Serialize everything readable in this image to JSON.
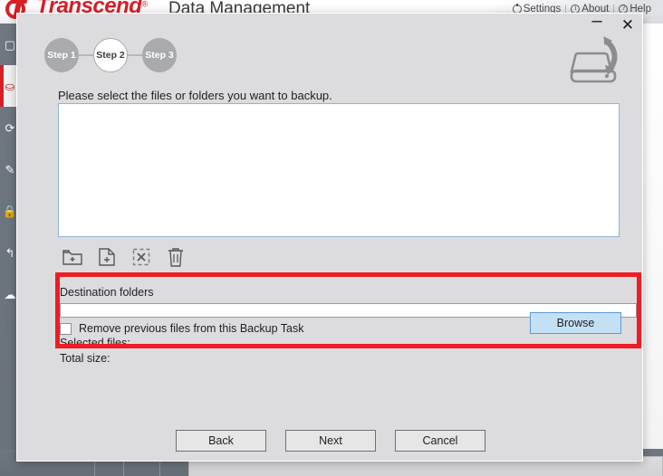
{
  "background": {
    "brand": "Transcend",
    "brand_reg": "®",
    "app_title": "Data Management",
    "header_links": [
      {
        "label": "Settings",
        "icon": "gear-icon"
      },
      {
        "label": "About",
        "icon": "info-icon"
      },
      {
        "label": "Help",
        "icon": "question-icon"
      }
    ],
    "sidebar_items": [
      {
        "icon": "lock-backup-icon",
        "glyph": "⛁",
        "active": true
      },
      {
        "icon": "sync-icon",
        "glyph": "⟳",
        "active": false
      },
      {
        "icon": "key-icon",
        "glyph": "✒",
        "active": false
      },
      {
        "icon": "padlock-icon",
        "glyph": "🔒",
        "active": false
      },
      {
        "icon": "restore-icon",
        "glyph": "↖",
        "active": false
      },
      {
        "icon": "cloud-icon",
        "glyph": "☁",
        "active": false
      }
    ]
  },
  "dialog": {
    "window_controls": {
      "minimize": "–",
      "close": "✕"
    },
    "steps": [
      {
        "label": "Step 1",
        "state": "done"
      },
      {
        "label": "Step 2",
        "state": "current"
      },
      {
        "label": "Step 3",
        "state": "done"
      }
    ],
    "hint": "Please select the files or folders you want to backup.",
    "filelist": {
      "items": [],
      "border_color": "#8fb6d9"
    },
    "toolbar": [
      {
        "name": "add-folder-icon",
        "title": "Add folder"
      },
      {
        "name": "add-file-icon",
        "title": "Add file"
      },
      {
        "name": "deselect-icon",
        "title": "Deselect"
      },
      {
        "name": "delete-icon",
        "title": "Delete"
      }
    ],
    "destination": {
      "label": "Destination folders",
      "input_value": "",
      "input_placeholder": "",
      "checkbox_label": "Remove previous files from this Backup Task",
      "checkbox_checked": false,
      "browse_label": "Browse",
      "highlight_color": "#ee1c24"
    },
    "stats": {
      "selected_files": "Selected files:",
      "total_size": "Total size:"
    },
    "footer": {
      "back": "Back",
      "next": "Next",
      "cancel": "Cancel"
    }
  }
}
